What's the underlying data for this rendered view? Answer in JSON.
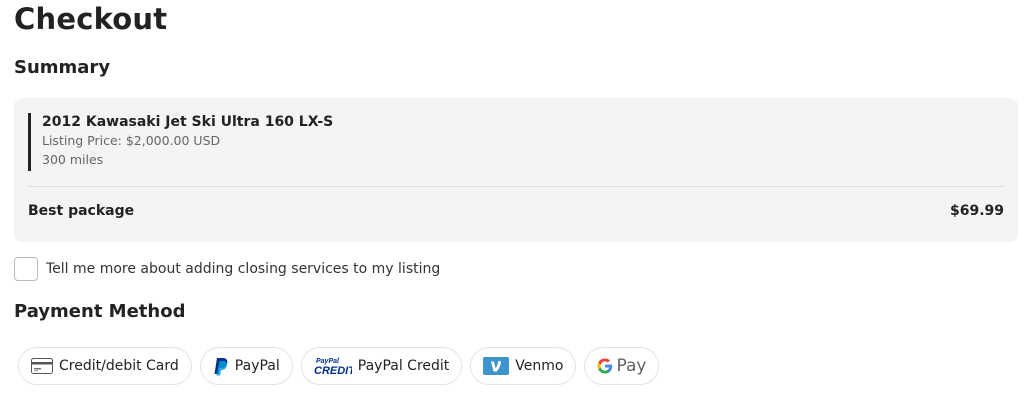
{
  "page": {
    "title": "Checkout"
  },
  "summary": {
    "heading": "Summary",
    "listing": {
      "title": "2012 Kawasaki Jet Ski Ultra 160 LX-S",
      "price_line": "Listing Price: $2,000.00 USD",
      "miles_line": "300 miles"
    },
    "package": {
      "label": "Best package",
      "price": "$69.99"
    }
  },
  "closing_services": {
    "label": "Tell me more about adding closing services to my listing",
    "checked": false
  },
  "payment": {
    "heading": "Payment Method",
    "methods": [
      {
        "label": "Credit/debit Card",
        "icon": "credit-card-icon"
      },
      {
        "label": "PayPal",
        "icon": "paypal-icon"
      },
      {
        "label": "PayPal Credit",
        "icon": "paypal-credit-icon",
        "icon_text_top": "PayPal",
        "icon_text_bottom": "CREDIT"
      },
      {
        "label": "Venmo",
        "icon": "venmo-icon"
      },
      {
        "label": "Pay",
        "icon": "google-g-icon"
      }
    ]
  },
  "colors": {
    "paypal_dark": "#003087",
    "paypal_light": "#009cde",
    "venmo": "#3d95ce",
    "card_bg": "#f4f4f4",
    "accent_bar": "#222222"
  }
}
